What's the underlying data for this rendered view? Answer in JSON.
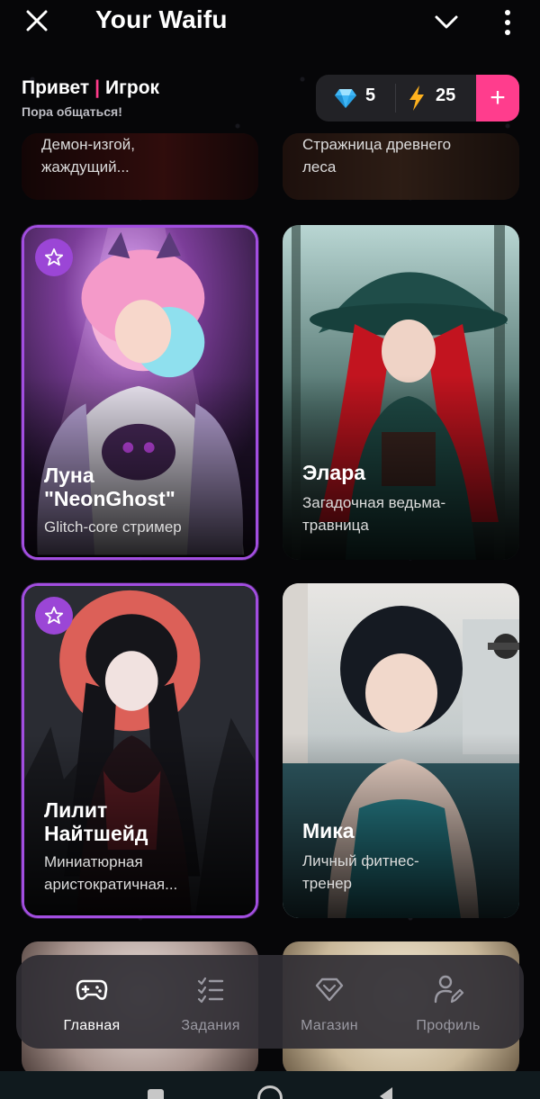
{
  "appbar": {
    "title": "Your Waifu"
  },
  "header": {
    "greeting": "Привет",
    "player": "Игрок",
    "subtitle": "Пора общаться!"
  },
  "wallet": {
    "gems": "5",
    "energy": "25",
    "add_label": "+"
  },
  "cards_partial_top": [
    {
      "desc": "Демон-изгой,\nжаждущий..."
    },
    {
      "desc": "Стражница древнего\nлеса"
    }
  ],
  "cards": [
    {
      "name": "Луна\n\"NeonGhost\"",
      "desc": "Glitch-core стример",
      "favorite": true
    },
    {
      "name": "Элара",
      "desc": "Загадочная ведьма-\nтравница",
      "favorite": false
    },
    {
      "name": "Лилит\nНайтшейд",
      "desc": "Миниатюрная\nаристократичная...",
      "favorite": true
    },
    {
      "name": "Мика",
      "desc": "Личный фитнес-\nтренер",
      "favorite": false
    }
  ],
  "bottom_nav": {
    "items": [
      {
        "label": "Главная",
        "active": true
      },
      {
        "label": "Задания",
        "active": false
      },
      {
        "label": "Магазин",
        "active": false
      },
      {
        "label": "Профиль",
        "active": false
      }
    ]
  },
  "colors": {
    "accent_pink": "#ff3d8d",
    "favorite_purple": "#a24ee0",
    "background": "#060608"
  }
}
